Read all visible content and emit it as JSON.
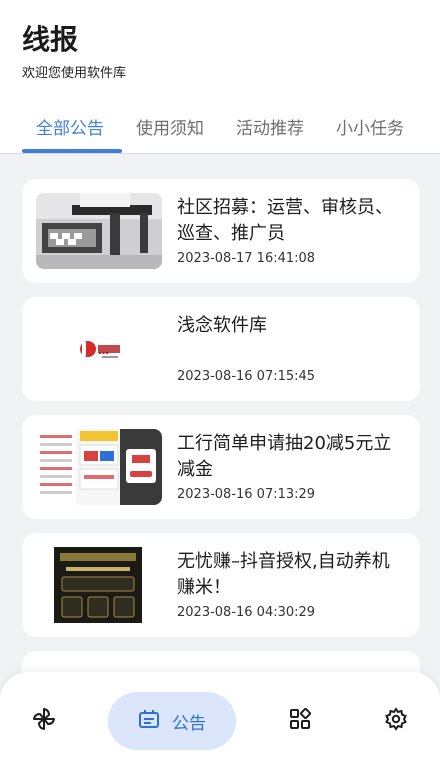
{
  "header": {
    "title": "线报",
    "subtitle": "欢迎您使用软件库"
  },
  "tabs": [
    {
      "label": "全部公告",
      "active": true
    },
    {
      "label": "使用须知",
      "active": false
    },
    {
      "label": "活动推荐",
      "active": false
    },
    {
      "label": "小小任务",
      "active": false
    }
  ],
  "posts": [
    {
      "title": "社区招募：运营、审核员、巡查、推广员",
      "date": "2023-08-17 16:41:08",
      "thumb": "photo-room-icon"
    },
    {
      "title": "浅念软件库",
      "date": "2023-08-16 07:15:45",
      "thumb": "logo-icon"
    },
    {
      "title": "工行简单申请抽20减5元立减金",
      "date": "2023-08-16 07:13:29",
      "thumb": "screenshot-icon"
    },
    {
      "title": "无忧赚–抖音授权,自动养机赚米！",
      "date": "2023-08-16 04:30:29",
      "thumb": "dark-poster-icon"
    }
  ],
  "bottom_nav": {
    "items": [
      {
        "icon": "pinwheel-icon"
      },
      {
        "icon": "announcement-icon",
        "label": "公告",
        "active": true
      },
      {
        "icon": "apps-grid-icon"
      },
      {
        "icon": "gear-icon"
      }
    ]
  },
  "colors": {
    "accent": "#3f7fd8",
    "background": "#f1f2f4",
    "active_pill": "#dbe6fb"
  }
}
